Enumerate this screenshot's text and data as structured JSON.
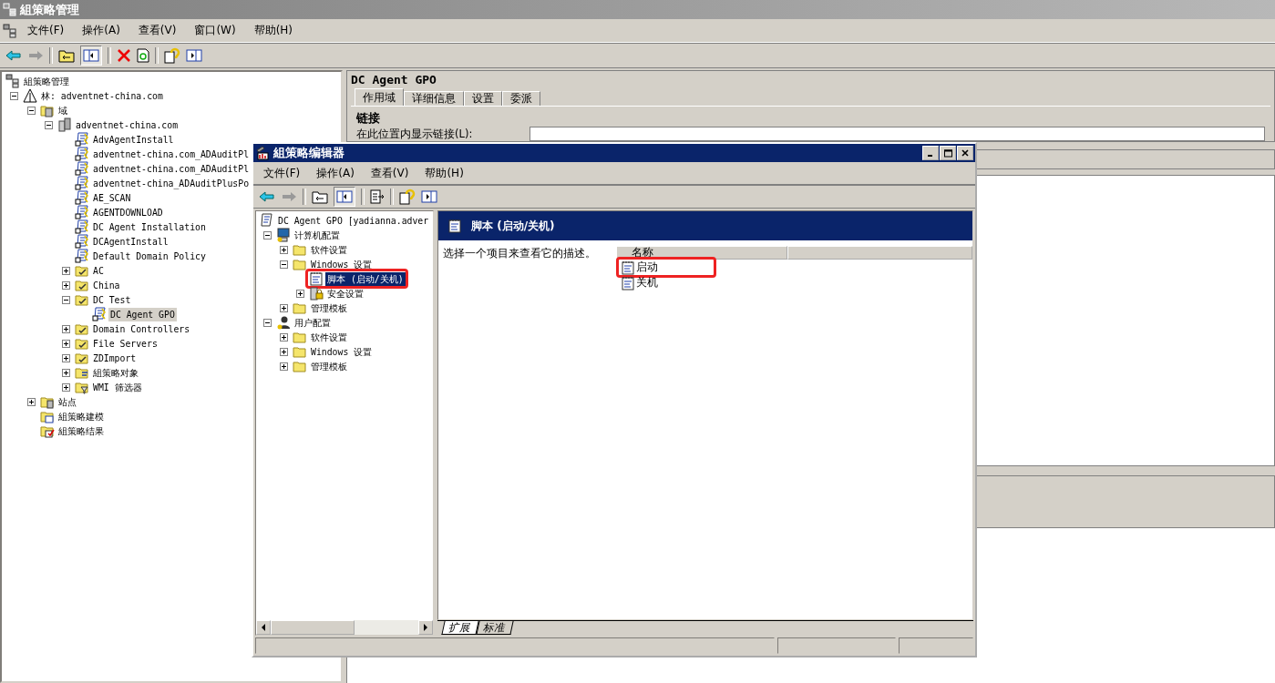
{
  "window": {
    "title": "組策略管理"
  },
  "menu": [
    "文件(F)",
    "操作(A)",
    "查看(V)",
    "窗口(W)",
    "帮助(H)"
  ],
  "tree": {
    "label": "組策略管理",
    "kind": "root",
    "selected": false,
    "children": [
      {
        "label": "林: adventnet-china.com",
        "kind": "forest",
        "expanded": true,
        "selected": false,
        "children": [
          {
            "label": "域",
            "kind": "domains",
            "expanded": true,
            "selected": false,
            "children": [
              {
                "label": "adventnet-china.com",
                "kind": "domain",
                "expanded": true,
                "selected": false,
                "children": [
                  {
                    "label": "AdvAgentInstall",
                    "kind": "gpo",
                    "selected": false
                  },
                  {
                    "label": "adventnet-china.com_ADAuditPl",
                    "kind": "gpo",
                    "selected": false
                  },
                  {
                    "label": "adventnet-china.com_ADAuditPl",
                    "kind": "gpo",
                    "selected": false
                  },
                  {
                    "label": "adventnet-china_ADAuditPlusPo",
                    "kind": "gpo",
                    "selected": false
                  },
                  {
                    "label": "AE_SCAN",
                    "kind": "gpo",
                    "selected": false
                  },
                  {
                    "label": "AGENTDOWNLOAD",
                    "kind": "gpo",
                    "selected": false
                  },
                  {
                    "label": "DC Agent Installation",
                    "kind": "gpo",
                    "selected": false
                  },
                  {
                    "label": "DCAgentInstall",
                    "kind": "gpo",
                    "selected": false
                  },
                  {
                    "label": "Default Domain Policy",
                    "kind": "gpo",
                    "selected": false
                  },
                  {
                    "label": "AC",
                    "kind": "ou",
                    "expanded": false,
                    "selected": false
                  },
                  {
                    "label": "China",
                    "kind": "ou",
                    "expanded": false,
                    "selected": false
                  },
                  {
                    "label": "DC Test",
                    "kind": "ou",
                    "expanded": true,
                    "selected": false,
                    "children": [
                      {
                        "label": "DC Agent GPO",
                        "kind": "gpo",
                        "selected": true
                      }
                    ]
                  },
                  {
                    "label": "Domain Controllers",
                    "kind": "ou",
                    "expanded": false,
                    "selected": false
                  },
                  {
                    "label": "File Servers",
                    "kind": "ou",
                    "expanded": false,
                    "selected": false
                  },
                  {
                    "label": "ZDImport",
                    "kind": "ou",
                    "expanded": false,
                    "selected": false
                  },
                  {
                    "label": "組策略对象",
                    "kind": "gpo-folder",
                    "expanded": false,
                    "selected": false
                  },
                  {
                    "label": "WMI 筛选器",
                    "kind": "wmi-folder",
                    "expanded": false,
                    "selected": false
                  }
                ]
              }
            ]
          },
          {
            "label": "站点",
            "kind": "sites",
            "expanded": false,
            "selected": false
          },
          {
            "label": "組策略建模",
            "kind": "modeling",
            "selected": false
          },
          {
            "label": "組策略结果",
            "kind": "results",
            "selected": false
          }
        ]
      }
    ]
  },
  "details": {
    "title": "DC Agent GPO",
    "tabs": [
      {
        "label": "作用域",
        "selected": true
      },
      {
        "label": "详细信息",
        "selected": false
      },
      {
        "label": "设置",
        "selected": false
      },
      {
        "label": "委派",
        "selected": false
      }
    ],
    "section": "链接",
    "link_label": "在此位置内显示链接(L):"
  },
  "editor": {
    "title": "組策略编辑器",
    "menu": [
      "文件(F)",
      "操作(A)",
      "查看(V)",
      "帮助(H)"
    ],
    "tree": {
      "label": "DC Agent GPO [yadianna.adver",
      "kind": "policy",
      "selected": false,
      "children": [
        {
          "label": "计算机配置",
          "kind": "computer",
          "expanded": true,
          "selected": false,
          "children": [
            {
              "label": "软件设置",
              "kind": "folder",
              "expanded": false,
              "selected": false
            },
            {
              "label": "Windows 设置",
              "kind": "folder",
              "expanded": true,
              "selected": false,
              "children": [
                {
                  "label": "脚本 (启动/关机)",
                  "kind": "script",
                  "selected": true,
                  "highlighted": true
                },
                {
                  "label": "安全设置",
                  "kind": "security",
                  "expanded": false,
                  "selected": false
                }
              ]
            },
            {
              "label": "管理模板",
              "kind": "folder",
              "expanded": false,
              "selected": false
            }
          ]
        },
        {
          "label": "用户配置",
          "kind": "user",
          "expanded": true,
          "selected": false,
          "children": [
            {
              "label": "软件设置",
              "kind": "folder",
              "expanded": false,
              "selected": false
            },
            {
              "label": "Windows 设置",
              "kind": "folder",
              "expanded": false,
              "selected": false
            },
            {
              "label": "管理模板",
              "kind": "folder",
              "expanded": false,
              "selected": false
            }
          ]
        }
      ]
    },
    "pane_title": "脚本 (启动/关机)",
    "description": "选择一个项目来查看它的描述。",
    "column": "名称",
    "items": [
      {
        "label": "启动",
        "selected": false,
        "highlighted": true
      },
      {
        "label": "关机",
        "selected": false,
        "highlighted": false
      }
    ],
    "view_tabs": [
      {
        "label": "扩展",
        "selected": true
      },
      {
        "label": "标准",
        "selected": false
      }
    ]
  }
}
